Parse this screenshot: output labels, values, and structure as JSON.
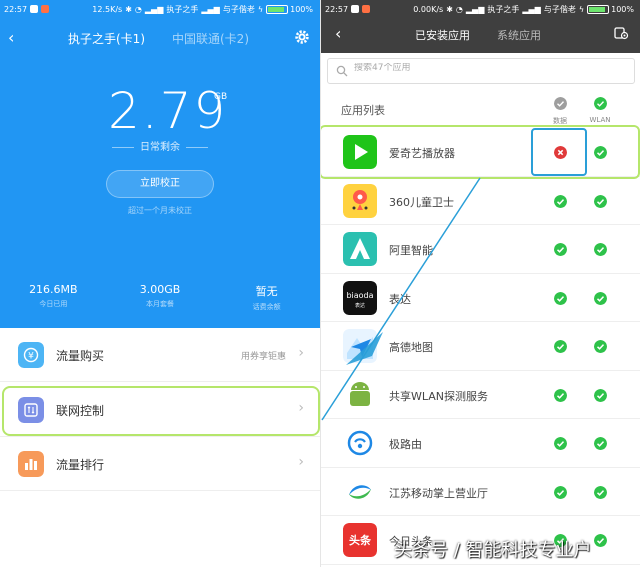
{
  "left": {
    "status": {
      "time": "22:57",
      "speed": "12.5K/s",
      "carrier1": "执子之手",
      "carrier2": "与子偕老",
      "battery": "100%"
    },
    "tabs": {
      "sim1": "执子之手(卡1)",
      "sim2": "中国联通(卡2)"
    },
    "remaining": {
      "value": "2.79",
      "unit": "GB",
      "label": "日常剩余"
    },
    "calibrate_button": "立即校正",
    "calibrate_note": "超过一个月未校正",
    "stats": [
      {
        "value": "216.6MB",
        "label": "今日已用"
      },
      {
        "value": "3.00GB",
        "label": "本月套餐"
      },
      {
        "value": "暂无",
        "label": "话费余额"
      }
    ],
    "menu": [
      {
        "label": "流量购买",
        "hint": "用券享钜惠",
        "color": "#4db5f5"
      },
      {
        "label": "联网控制",
        "hint": "",
        "color": "#7b8fe6"
      },
      {
        "label": "流量排行",
        "hint": "",
        "color": "#f79a5a"
      }
    ]
  },
  "right": {
    "status": {
      "time": "22:57",
      "speed": "0.00K/s",
      "carrier1": "执子之手",
      "carrier2": "与子偕老",
      "battery": "100%"
    },
    "tabs": {
      "installed": "已安装应用",
      "system": "系统应用"
    },
    "search_placeholder": "搜索47个应用",
    "list_title": "应用列表",
    "col_data": "数据",
    "col_wlan": "WLAN",
    "apps": [
      {
        "name": "爱奇艺播放器",
        "data_on": false,
        "wlan_on": true,
        "icon": "iqiyi-icon",
        "icon_color": "#1fc419"
      },
      {
        "name": "360儿童卫士",
        "data_on": true,
        "wlan_on": true,
        "icon": "child-guard-icon",
        "icon_color": "#ffd23f"
      },
      {
        "name": "阿里智能",
        "data_on": true,
        "wlan_on": true,
        "icon": "ali-smart-icon",
        "icon_color": "#2bc0b0"
      },
      {
        "name": "表达",
        "data_on": true,
        "wlan_on": true,
        "icon": "biaoda-icon",
        "icon_color": "#111111",
        "icon_text": "biaoda",
        "icon_sub": "表达"
      },
      {
        "name": "高德地图",
        "data_on": true,
        "wlan_on": true,
        "icon": "amap-icon",
        "icon_color": "#e8f4ff"
      },
      {
        "name": "共享WLAN探测服务",
        "data_on": true,
        "wlan_on": true,
        "icon": "android-icon",
        "icon_color": "#ffffff"
      },
      {
        "name": "极路由",
        "data_on": true,
        "wlan_on": true,
        "icon": "hiwifi-icon",
        "icon_color": "#ffffff"
      },
      {
        "name": "江苏移动掌上营业厅",
        "data_on": true,
        "wlan_on": true,
        "icon": "china-mobile-icon",
        "icon_color": "#ffffff"
      },
      {
        "name": "今日头条",
        "data_on": true,
        "wlan_on": true,
        "icon": "toutiao-icon",
        "icon_color": "#e8332f",
        "icon_text": "头条"
      }
    ],
    "colors": {
      "on": "#2ec24a",
      "off": "#e03a3a",
      "highlight": "#b5e66b",
      "focus": "#2a9fd8"
    }
  },
  "watermark": "头条号 / 智能科技专业户"
}
